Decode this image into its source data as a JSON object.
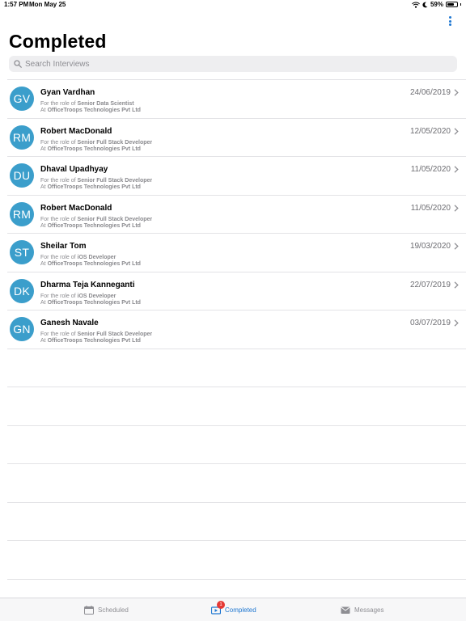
{
  "status_bar": {
    "time": "1:57 PM",
    "date": "Mon May 25",
    "battery_percent": "59%",
    "battery_level": 0.59
  },
  "header": {
    "title": "Completed",
    "menu_icon": "more-vertical-icon"
  },
  "search": {
    "placeholder": "Search Interviews",
    "value": ""
  },
  "interviews": [
    {
      "initials": "GV",
      "name": "Gyan Vardhan",
      "date": "24/06/2019",
      "role_prefix": "For the role of",
      "role": "Senior Data Scientist",
      "company_prefix": "At",
      "company": "OfficeTroops Technologies Pvt Ltd"
    },
    {
      "initials": "RM",
      "name": "Robert MacDonald",
      "date": "12/05/2020",
      "role_prefix": "For the role of",
      "role": "Senior Full Stack Developer",
      "company_prefix": "At",
      "company": "OfficeTroops Technologies Pvt Ltd"
    },
    {
      "initials": "DU",
      "name": "Dhaval Upadhyay",
      "date": "11/05/2020",
      "role_prefix": "For the role of",
      "role": "Senior Full Stack Developer",
      "company_prefix": "At",
      "company": "OfficeTroops Technologies Pvt Ltd"
    },
    {
      "initials": "RM",
      "name": "Robert MacDonald",
      "date": "11/05/2020",
      "role_prefix": "For the role of",
      "role": "Senior Full Stack Developer",
      "company_prefix": "At",
      "company": "OfficeTroops Technologies Pvt Ltd"
    },
    {
      "initials": "ST",
      "name": "Sheilar Tom",
      "date": "19/03/2020",
      "role_prefix": "For the role of",
      "role": "iOS Developer",
      "company_prefix": "At",
      "company": "OfficeTroops Technologies Pvt Ltd"
    },
    {
      "initials": "DK",
      "name": "Dharma Teja Kanneganti",
      "date": "22/07/2019",
      "role_prefix": "For the role of",
      "role": "iOS Developer",
      "company_prefix": "At",
      "company": "OfficeTroops Technologies Pvt Ltd"
    },
    {
      "initials": "GN",
      "name": "Ganesh Navale",
      "date": "03/07/2019",
      "role_prefix": "For the role of",
      "role": "Senior Full Stack Developer",
      "company_prefix": "At",
      "company": "OfficeTroops Technologies Pvt Ltd"
    }
  ],
  "tabs": [
    {
      "label": "Scheduled",
      "icon": "calendar-icon",
      "active": false
    },
    {
      "label": "Completed",
      "icon": "video-icon",
      "active": true,
      "badge": "1"
    },
    {
      "label": "Messages",
      "icon": "envelope-icon",
      "active": false
    }
  ],
  "colors": {
    "accent": "#1f77d1",
    "avatar": "#3b9ecb",
    "badge": "#e53935"
  }
}
